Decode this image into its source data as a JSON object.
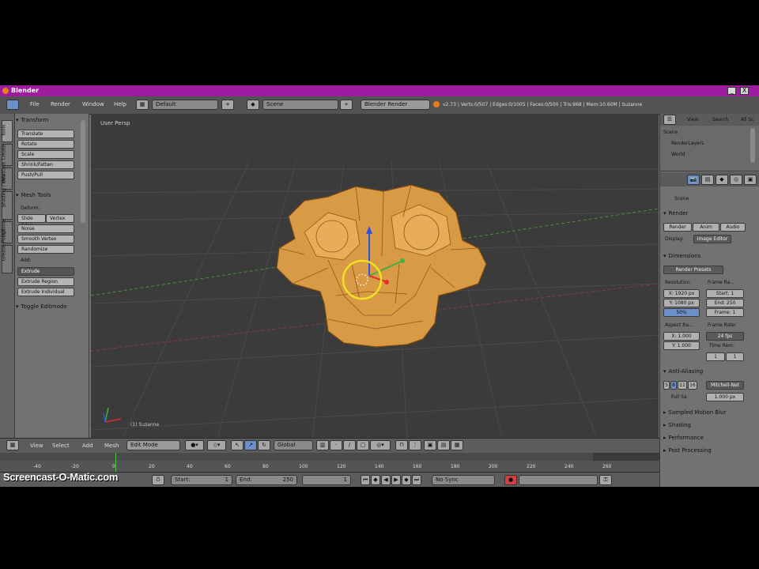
{
  "window": {
    "title": "Blender",
    "minimize": "_",
    "close": "X"
  },
  "infobar": {
    "menus": [
      "File",
      "Render",
      "Window",
      "Help"
    ],
    "screen_layout": "Default",
    "scene": "Scene",
    "render_engine": "Blender Render",
    "stats": "v2.73 | Verts:0/507 | Edges:0/1005 | Faces:0/500 | Tris:968 | Mem:10.60M | Suzanne"
  },
  "toolshelf": {
    "tabs": [
      "Tools",
      "Create",
      "Relations",
      "Shading / UVs",
      "Options",
      "Grease Pencil"
    ],
    "transform_header": "Transform",
    "transform_buttons": [
      "Translate",
      "Rotate",
      "Scale",
      "Shrink/Fatten",
      "Push/Pull"
    ],
    "mesh_tools_header": "Mesh Tools",
    "deform_label": "Deform:",
    "deform_buttons": [
      "Slide Edge",
      "Vertex"
    ],
    "deform_more": [
      "Noise",
      "Smooth Vertex",
      "Randomize"
    ],
    "add_label": "Add:",
    "extrude": "Extrude",
    "extrude_region": "Extrude Region",
    "extrude_individual": "Extrude Individual",
    "toggle_header": "Toggle Editmode"
  },
  "viewport": {
    "view_label": "User Persp",
    "object_label": "(1) Suzanne",
    "colors": {
      "background": "#3b3b3b",
      "mesh": "#e0a24a",
      "wire": "#7a4a10",
      "cursor": "#f0e020"
    }
  },
  "viewport_header": {
    "menus": [
      "View",
      "Select",
      "Add",
      "Mesh"
    ],
    "mode": "Edit Mode",
    "orientation": "Global"
  },
  "timeline": {
    "ticks": [
      "-40",
      "-20",
      "0",
      "20",
      "40",
      "60",
      "80",
      "100",
      "120",
      "140",
      "160",
      "180",
      "200",
      "220",
      "240",
      "260"
    ],
    "start_label": "Start:",
    "start_value": "1",
    "end_label": "End:",
    "end_value": "250",
    "current_frame": "1",
    "sync": "No Sync"
  },
  "outliner": {
    "tabs": [
      "View",
      "Search",
      "All Sc"
    ],
    "items": [
      "Scene",
      "RenderLayers",
      "World"
    ]
  },
  "properties": {
    "context": "Scene",
    "render_header": "Render",
    "render_buttons": [
      "Render",
      "Anim",
      "Audio"
    ],
    "display_label": "Display:",
    "display_value": "Image Editor",
    "dimensions_header": "Dimensions",
    "presets": "Render Presets",
    "resolution_label": "Resolution:",
    "res_x": "X: 1920 px",
    "res_y": "Y: 1080 px",
    "res_pct": "50%",
    "frame_range_label": "Frame Ra...",
    "frame_start": "Start: 1",
    "frame_end": "End: 250",
    "frame_step": "Frame: 1",
    "aspect_label": "Aspect Ra...",
    "aspect_x": "X: 1.000",
    "aspect_y": "Y: 1.000",
    "frame_rate_label": "Frame Rate:",
    "frame_rate": "24 fps",
    "time_remap_label": "Time Rem:",
    "time_old": "1",
    "time_new": "1",
    "aa_header": "Anti-Aliasing",
    "aa_samples": [
      "5",
      "8",
      "11",
      "16"
    ],
    "aa_filter": "Mitchell-Net",
    "full_sample": "Full Sa",
    "filter_size": "1.000 px",
    "closed_sections": [
      "Sampled Motion Blur",
      "Shading",
      "Performance",
      "Post Processing"
    ]
  },
  "watermark": "Screencast-O-Matic.com"
}
